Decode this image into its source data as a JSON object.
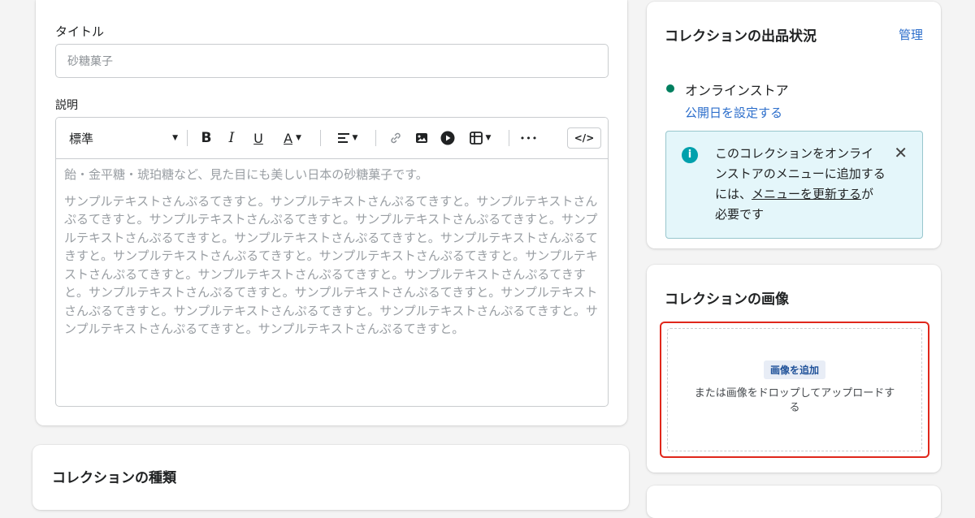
{
  "main": {
    "title_label": "タイトル",
    "title_value": "砂糖菓子",
    "description_label": "説明",
    "toolbar": {
      "paragraph_style": "標準",
      "bold": "B",
      "italic": "I",
      "underline": "U",
      "text_color": "A",
      "more": "•••",
      "code": "</>"
    },
    "description_paragraphs": [
      "飴・金平糖・琥珀糖など、見た目にも美しい日本の砂糖菓子です。",
      "サンプルテキストさんぷるてきすと。サンプルテキストさんぷるてきすと。サンプルテキストさんぷるてきすと。サンプルテキストさんぷるてきすと。サンプルテキストさんぷるてきすと。サンプルテキストさんぷるてきすと。サンプルテキストさんぷるてきすと。サンプルテキストさんぷるてきすと。サンプルテキストさんぷるてきすと。サンプルテキストさんぷるてきすと。サンプルテキストさんぷるてきすと。サンプルテキストさんぷるてきすと。サンプルテキストさんぷるてきすと。サンプルテキストさんぷるてきすと。サンプルテキストさんぷるてきすと。サンプルテキストさんぷるてきすと。サンプルテキストさんぷるてきすと。サンプルテキストさんぷるてきすと。サンプルテキストさんぷるてきすと。サンプルテキストさんぷるてきすと。"
    ]
  },
  "collection_type": {
    "title": "コレクションの種類"
  },
  "availability": {
    "title": "コレクションの出品状況",
    "manage": "管理",
    "channel": "オンラインストア",
    "schedule_link": "公開日を設定する",
    "banner": {
      "text_before": "このコレクションをオンラインストアのメニューに追加するには、",
      "link": "メニューを更新する",
      "text_after": "が必要です"
    }
  },
  "image": {
    "title": "コレクションの画像",
    "add_button": "画像を追加",
    "hint": "または画像をドロップしてアップロードする"
  },
  "colors": {
    "link": "#2c6ecb",
    "status_dot": "#007f5f",
    "banner_bg": "#e4f6fa",
    "highlight": "#e0271b"
  },
  "icons": [
    "chevron-down-icon",
    "link-icon",
    "image-icon",
    "video-icon",
    "table-icon",
    "info-icon",
    "close-icon",
    "code-icon"
  ]
}
